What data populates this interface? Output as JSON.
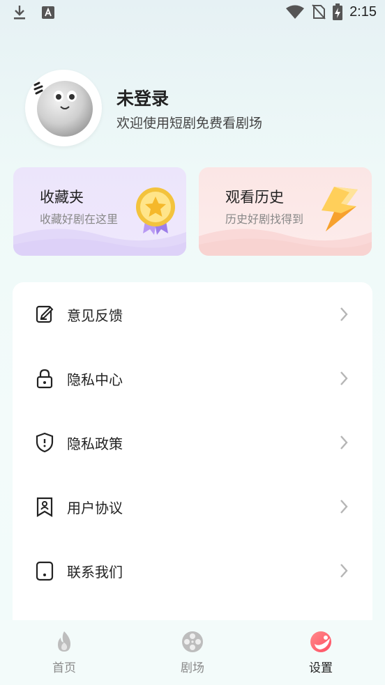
{
  "status_bar": {
    "time": "2:15",
    "icons": [
      "download-icon",
      "a-notification-icon",
      "wifi-icon",
      "no-signal-icon",
      "battery-charging-icon"
    ]
  },
  "profile": {
    "name": "未登录",
    "subtitle": "欢迎使用短剧免费看剧场"
  },
  "cards": {
    "favorites": {
      "title": "收藏夹",
      "subtitle": "收藏好剧在这里",
      "icon": "star-medal-icon"
    },
    "history": {
      "title": "观看历史",
      "subtitle": "历史好剧找得到",
      "icon": "lightning-icon"
    }
  },
  "menu": {
    "items": [
      {
        "label": "意见反馈",
        "icon": "feedback-edit-icon"
      },
      {
        "label": "隐私中心",
        "icon": "lock-icon"
      },
      {
        "label": "隐私政策",
        "icon": "shield-icon"
      },
      {
        "label": "用户协议",
        "icon": "user-agreement-icon"
      },
      {
        "label": "联系我们",
        "icon": "contact-phone-icon"
      }
    ]
  },
  "tabbar": {
    "tabs": [
      {
        "label": "首页",
        "icon": "flame-icon",
        "active": false
      },
      {
        "label": "剧场",
        "icon": "film-reel-icon",
        "active": false
      },
      {
        "label": "设置",
        "icon": "settings-ball-icon",
        "active": true
      }
    ]
  },
  "colors": {
    "accent": "#ff5b6b",
    "favorites_bg": "#ece5fb",
    "history_bg": "#fbe6e5",
    "medal_gold": "#f5c53a",
    "lightning_orange": "#ffb13b"
  }
}
